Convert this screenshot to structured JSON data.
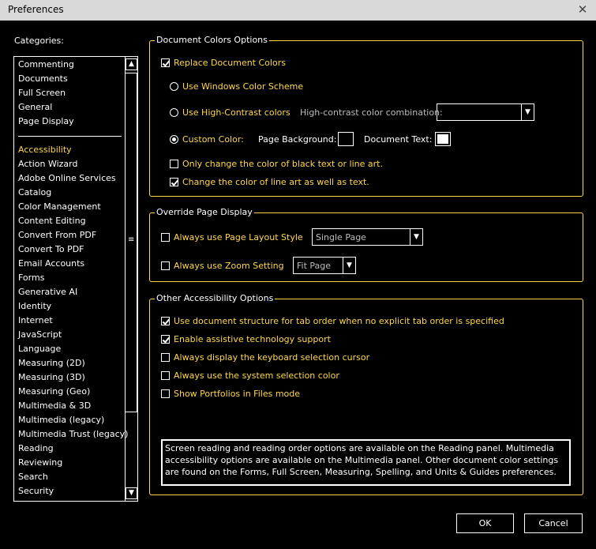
{
  "window": {
    "title": "Preferences",
    "close_glyph": "✕"
  },
  "sidebar": {
    "label": "Categories:",
    "group1": [
      "Commenting",
      "Documents",
      "Full Screen",
      "General",
      "Page Display"
    ],
    "group2": [
      "Accessibility",
      "Action Wizard",
      "Adobe Online Services",
      "Catalog",
      "Color Management",
      "Content Editing",
      "Convert From PDF",
      "Convert To PDF",
      "Email Accounts",
      "Forms",
      "Generative AI",
      "Identity",
      "Internet",
      "JavaScript",
      "Language",
      "Measuring (2D)",
      "Measuring (3D)",
      "Measuring (Geo)",
      "Multimedia & 3D",
      "Multimedia (legacy)",
      "Multimedia Trust (legacy)",
      "Reading",
      "Reviewing",
      "Search",
      "Security"
    ],
    "selected": "Accessibility"
  },
  "doc_colors": {
    "legend": "Document Colors Options",
    "replace_label": "Replace Document Colors",
    "replace_checked": true,
    "windows_scheme_label": "Use Windows Color Scheme",
    "high_contrast_label": "Use High-Contrast colors",
    "high_contrast_combo_label": "High-contrast color combination:",
    "high_contrast_combo_value": "",
    "custom_label": "Custom Color:",
    "page_bg_label": "Page Background:",
    "page_bg_color": "#000000",
    "doc_text_label": "Document Text:",
    "doc_text_color": "#ffffff",
    "only_black_label": "Only change the color of black text or line art.",
    "only_black_checked": false,
    "line_art_label": "Change the color of line art as well as text.",
    "line_art_checked": true
  },
  "override": {
    "legend": "Override Page Display",
    "layout_label": "Always use Page Layout Style",
    "layout_value": "Single Page",
    "zoom_label": "Always use Zoom Setting",
    "zoom_value": "Fit Page"
  },
  "other": {
    "legend": "Other Accessibility Options",
    "items": [
      {
        "label": "Use document structure for tab order when no explicit tab order is specified",
        "checked": true
      },
      {
        "label": "Enable assistive technology support",
        "checked": true
      },
      {
        "label": "Always display the keyboard selection cursor",
        "checked": false
      },
      {
        "label": "Always use the system selection color",
        "checked": false
      },
      {
        "label": "Show Portfolios in Files mode",
        "checked": false
      }
    ],
    "info": "Screen reading and reading order options are available on the Reading panel. Multimedia accessibility options are available on the Multimedia panel. Other document color settings are found on the Forms, Full Screen, Measuring, Spelling, and Units & Guides preferences."
  },
  "buttons": {
    "ok": "OK",
    "cancel": "Cancel"
  },
  "colors": {
    "accent": "#ffd84a",
    "background": "#000000",
    "titlebar": "#d9d9d9"
  }
}
